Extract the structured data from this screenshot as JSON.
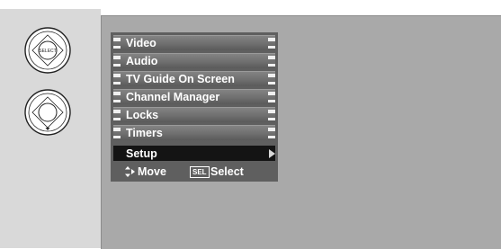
{
  "remote": {
    "select_button_label": "SELECT"
  },
  "menu": {
    "items": [
      {
        "label": "Video"
      },
      {
        "label": "Audio"
      },
      {
        "label": "TV Guide On Screen"
      },
      {
        "label": "Channel Manager"
      },
      {
        "label": "Locks"
      },
      {
        "label": "Timers"
      },
      {
        "label": "Setup"
      }
    ],
    "selected_item": "Setup"
  },
  "hints": {
    "move_label": "Move",
    "select_key": "SEL",
    "select_label": "Select"
  },
  "colors": {
    "screen_bg": "#a9a9a9",
    "menu_bg": "#5f5f5f",
    "selected_bg": "#141414",
    "text": "#ffffff"
  },
  "icons": [
    "select-button-icon",
    "down-arrow-button-icon",
    "move-arrows-icon",
    "submenu-arrow-icon"
  ]
}
